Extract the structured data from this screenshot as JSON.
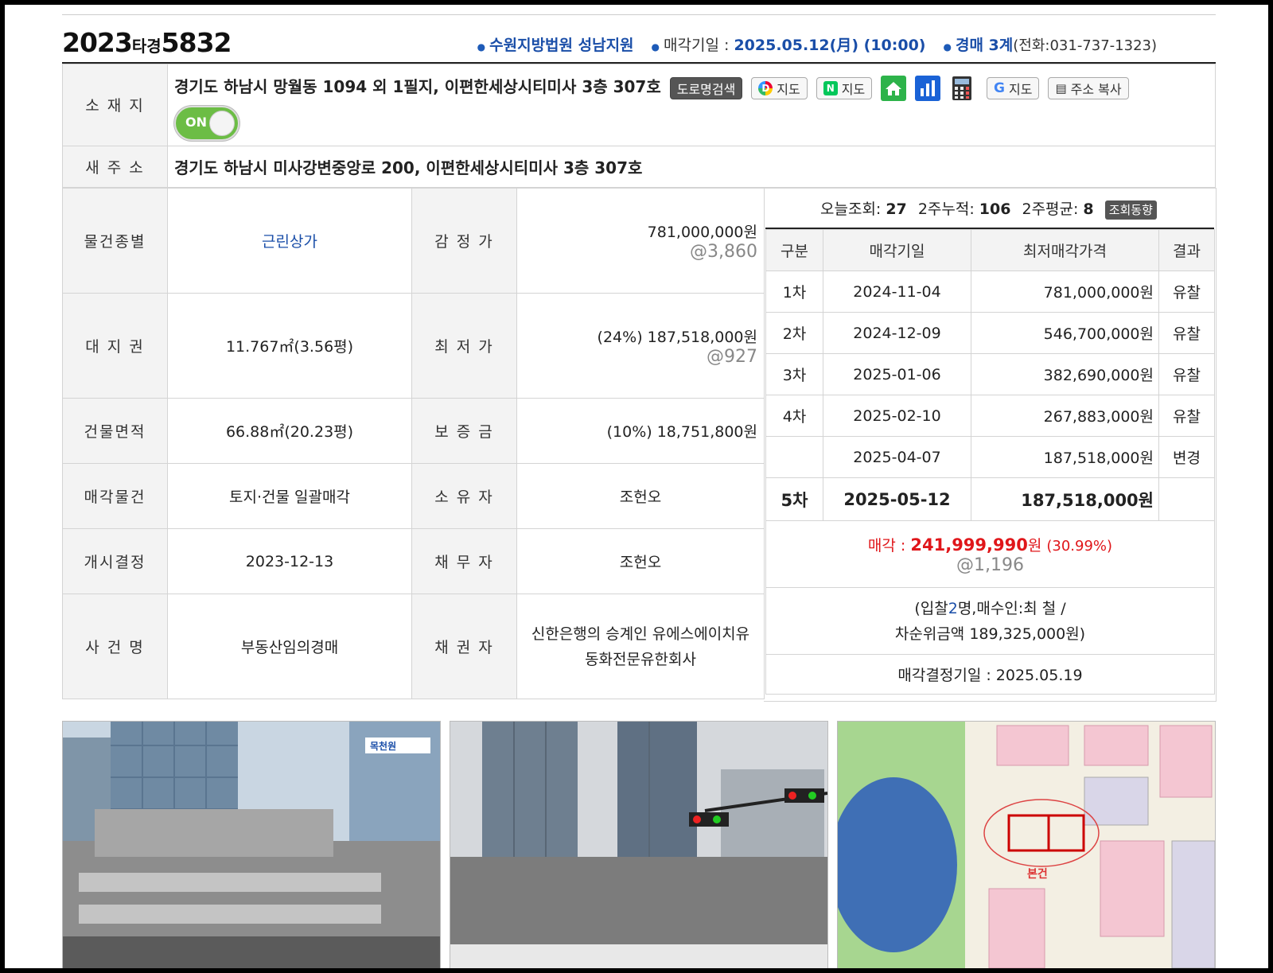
{
  "case": {
    "year": "2023",
    "type": "타경",
    "number": "5832"
  },
  "header": {
    "court": "수원지방법원 성남지원",
    "sale_date_label": "매각기일 :",
    "sale_date": "2025.05.12(月) (10:00)",
    "division": "경매 3계",
    "phone": "(전화:031-737-1323)"
  },
  "location": {
    "label": "소 재 지",
    "address": "경기도 하남시 망월동 1094 외 1필지, 이편한세상시티미사 3층 307호",
    "buttons": {
      "road_search": "도로명검색",
      "daum_map": "지도",
      "naver_map": "지도",
      "google_map": "지도",
      "copy_address": "주소 복사"
    },
    "toggle": "ON"
  },
  "new_address": {
    "label": "새 주 소",
    "value": "경기도 하남시 미사강변중앙로 200, 이편한세상시티미사 3층 307호"
  },
  "details": {
    "type_label": "물건종별",
    "type_value": "근린상가",
    "appraisal_label": "감 정 가",
    "appraisal_value": "781,000,000원",
    "appraisal_sub": "@3,860",
    "land_label": "대 지 권",
    "land_value": "11.767㎡(3.56평)",
    "min_label": "최 저 가",
    "min_value": "(24%) 187,518,000원",
    "min_sub": "@927",
    "bldg_label": "건물면적",
    "bldg_value": "66.88㎡(20.23평)",
    "deposit_label": "보 증 금",
    "deposit_value": "(10%) 18,751,800원",
    "sale_obj_label": "매각물건",
    "sale_obj_value": "토지·건물 일괄매각",
    "owner_label": "소 유 자",
    "owner_value": "조헌오",
    "start_label": "개시결정",
    "start_value": "2023-12-13",
    "debtor_label": "채 무 자",
    "debtor_value": "조헌오",
    "case_label": "사 건 명",
    "case_value": "부동산임의경매",
    "creditor_label": "채 권 자",
    "creditor_line1": "신한은행의 승계인 유에스에이치유",
    "creditor_line2": "동화전문유한회사"
  },
  "stats": {
    "today_label": "오늘조회:",
    "today": "27",
    "two_week_label": "2주누적:",
    "two_week": "106",
    "avg_label": "2주평균:",
    "avg": "8",
    "trend_button": "조회동향"
  },
  "history": {
    "headers": [
      "구분",
      "매각기일",
      "최저매각가격",
      "결과"
    ],
    "rows": [
      {
        "round": "1차",
        "date": "2024-11-04",
        "price": "781,000,000원",
        "result": "유찰"
      },
      {
        "round": "2차",
        "date": "2024-12-09",
        "price": "546,700,000원",
        "result": "유찰"
      },
      {
        "round": "3차",
        "date": "2025-01-06",
        "price": "382,690,000원",
        "result": "유찰"
      },
      {
        "round": "4차",
        "date": "2025-02-10",
        "price": "267,883,000원",
        "result": "유찰"
      },
      {
        "round": "",
        "date": "2025-04-07",
        "price": "187,518,000원",
        "result": "변경"
      },
      {
        "round": "5차",
        "date": "2025-05-12",
        "price": "187,518,000원",
        "result": ""
      }
    ],
    "sold_label": "매각 :",
    "sold_price": "241,999,990",
    "sold_unit": "원",
    "sold_ratio": "(30.99%)",
    "sold_sub": "@1,196",
    "bid_prefix": "(입찰",
    "bid_count": "2",
    "bid_suffix": "명,매수인:최 철 /",
    "second_bid": "차순위금액 189,325,000원)",
    "decision": "매각결정기일 : 2025.05.19"
  },
  "photos": {
    "sign_text": "목천원",
    "map_label": "본건"
  },
  "colors": {
    "blue": "#1a4ea8",
    "red": "#e0161a",
    "toggle": "#6cbd45"
  }
}
